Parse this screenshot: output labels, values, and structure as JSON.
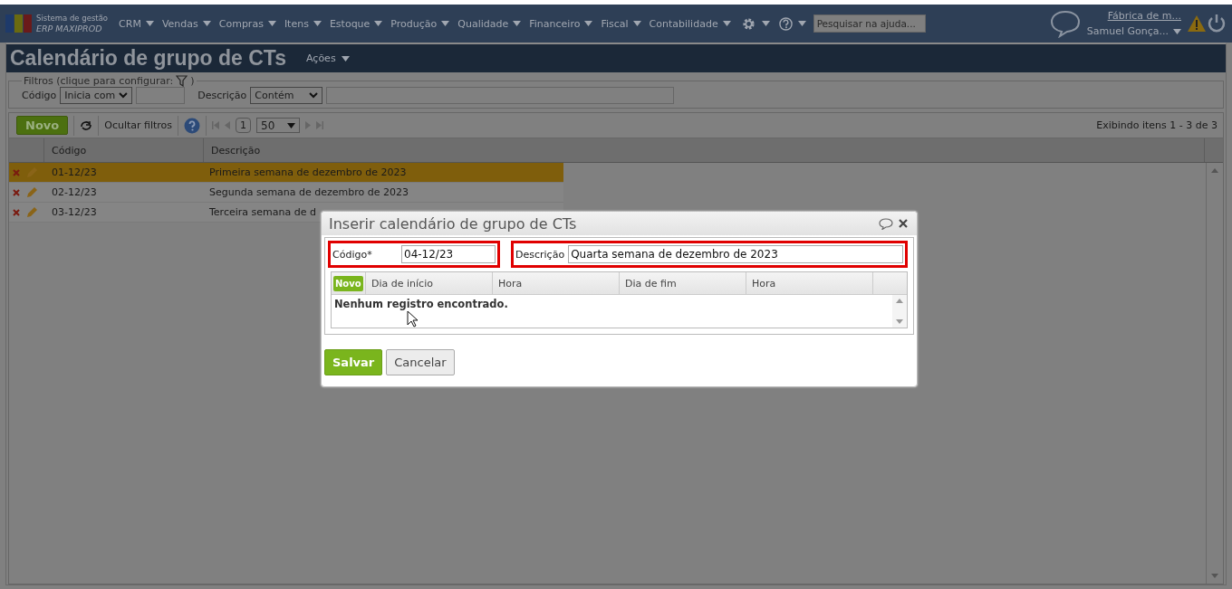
{
  "app": {
    "logo_line1": "Sistema de gestão",
    "logo_line2": "ERP MAXIPROD"
  },
  "menu": [
    {
      "label": "CRM"
    },
    {
      "label": "Vendas"
    },
    {
      "label": "Compras"
    },
    {
      "label": "Itens"
    },
    {
      "label": "Estoque"
    },
    {
      "label": "Produção"
    },
    {
      "label": "Qualidade"
    },
    {
      "label": "Financeiro"
    },
    {
      "label": "Fiscal"
    },
    {
      "label": "Contabilidade"
    }
  ],
  "help_search": {
    "placeholder": "Pesquisar na ajuda..."
  },
  "company_link": "Fábrica de m...",
  "user": "Samuel Gonça...",
  "page": {
    "title": "Calendário de grupo de CTs",
    "actions": "Ações"
  },
  "filters": {
    "legend": "Filtros (clique para configurar:",
    "legend_end": ")",
    "fields": [
      {
        "label": "Código",
        "operator": "Inicia com"
      },
      {
        "label": "Descrição",
        "operator": "Contém"
      }
    ]
  },
  "toolbar": {
    "new_button": "Novo",
    "hide_filters": "Ocultar filtros",
    "page": "1",
    "page_size": "50",
    "summary": "Exibindo itens 1 - 3 de 3"
  },
  "table": {
    "columns": [
      "Código",
      "Descrição"
    ],
    "rows": [
      {
        "code": "01-12/23",
        "description": "Primeira semana de dezembro de 2023",
        "selected": true
      },
      {
        "code": "02-12/23",
        "description": "Segunda semana de dezembro de 2023",
        "selected": false
      },
      {
        "code": "03-12/23",
        "description": "Terceira semana de d",
        "selected": false
      }
    ]
  },
  "dialog": {
    "title": "Inserir calendário de grupo de CTs",
    "fields": [
      {
        "label": "Código*",
        "value": "04-12/23",
        "highlighted": true
      },
      {
        "label": "Descrição",
        "value": "Quarta semana de dezembro de 2023",
        "highlighted": true
      }
    ],
    "subgrid": {
      "new_button": "Novo",
      "columns": [
        "Dia de início",
        "Hora",
        "Dia de fim",
        "Hora"
      ],
      "empty_message": "Nenhum registro encontrado."
    },
    "buttons": {
      "save": "Salvar",
      "cancel": "Cancelar"
    }
  }
}
